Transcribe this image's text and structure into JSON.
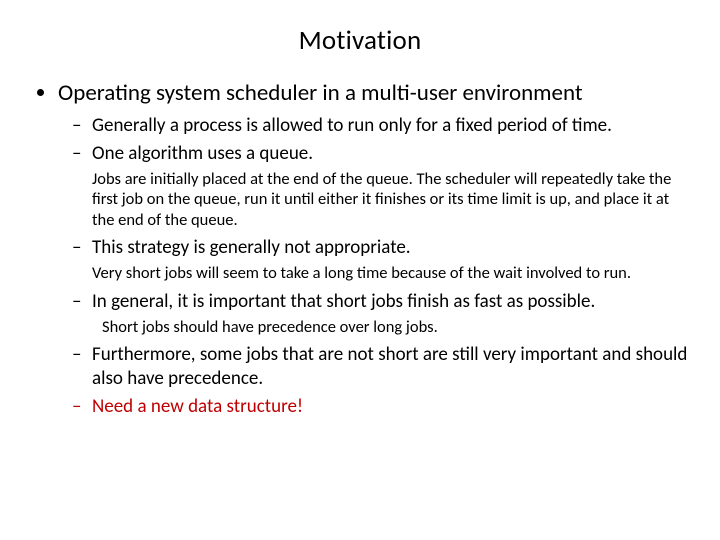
{
  "title": "Motivation",
  "lvl1": {
    "item1": "Operating system scheduler in a multi-user environment"
  },
  "lvl2": {
    "a": "Generally a process is allowed to run only for a fixed period of time.",
    "b": "One algorithm uses a queue.",
    "c": "This strategy is generally not appropriate.",
    "d": "In general, it is important that short jobs finish as fast as possible.",
    "e": "Furthermore, some jobs that are not short are still very important and should also have precedence.",
    "f": "Need a new data structure!"
  },
  "para": {
    "p1": "Jobs are initially placed at the end of the queue. The scheduler will repeatedly take the first job on the queue, run it until either it finishes or its time limit is up, and place it at the end of the queue.",
    "p2": "Very short jobs will seem to take a long time because of the wait involved to run.",
    "p3": "Short jobs should have precedence over long jobs."
  }
}
